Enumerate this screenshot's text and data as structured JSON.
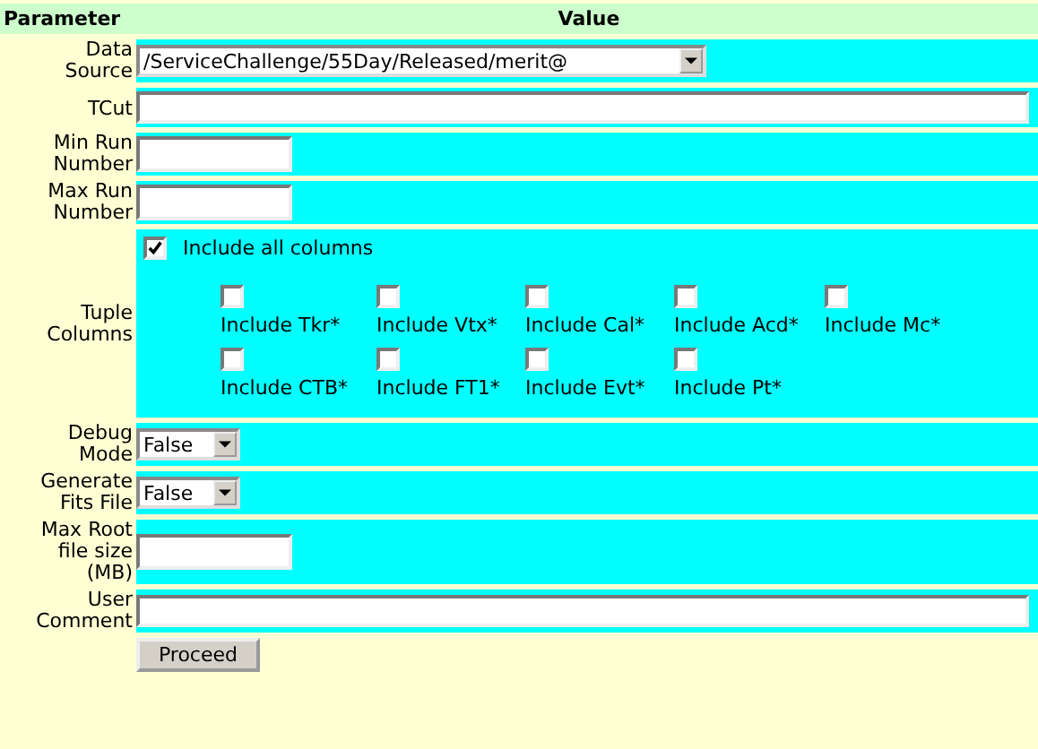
{
  "header": {
    "parameter": "Parameter",
    "value": "Value"
  },
  "rows": [
    {
      "kind": "select",
      "label": "Data Source",
      "value": "/ServiceChallenge/55Day/Released/merit@"
    },
    {
      "kind": "text",
      "label": "TCut"
    },
    {
      "kind": "text",
      "label": "Min Run Number"
    },
    {
      "kind": "text",
      "label": "Max Run Number"
    },
    {
      "kind": "columns",
      "label": "Tuple Columns",
      "all": {
        "label": "Include all columns",
        "checked": true
      },
      "options": [
        {
          "label": "Include Tkr*",
          "checked": false
        },
        {
          "label": "Include Vtx*",
          "checked": false
        },
        {
          "label": "Include Cal*",
          "checked": false
        },
        {
          "label": "Include Acd*",
          "checked": false
        },
        {
          "label": "Include Mc*",
          "checked": false
        },
        {
          "label": "Include CTB*",
          "checked": false
        },
        {
          "label": "Include FT1*",
          "checked": false
        },
        {
          "label": "Include Evt*",
          "checked": false
        },
        {
          "label": "Include Pt*",
          "checked": false
        }
      ]
    },
    {
      "kind": "select",
      "label": "Debug Mode",
      "value": "False"
    },
    {
      "kind": "select",
      "label": "Generate Fits File",
      "value": "False"
    },
    {
      "kind": "text",
      "label": "Max Root file size (MB)"
    },
    {
      "kind": "text",
      "label": "User Comment"
    }
  ],
  "button": "Proceed"
}
